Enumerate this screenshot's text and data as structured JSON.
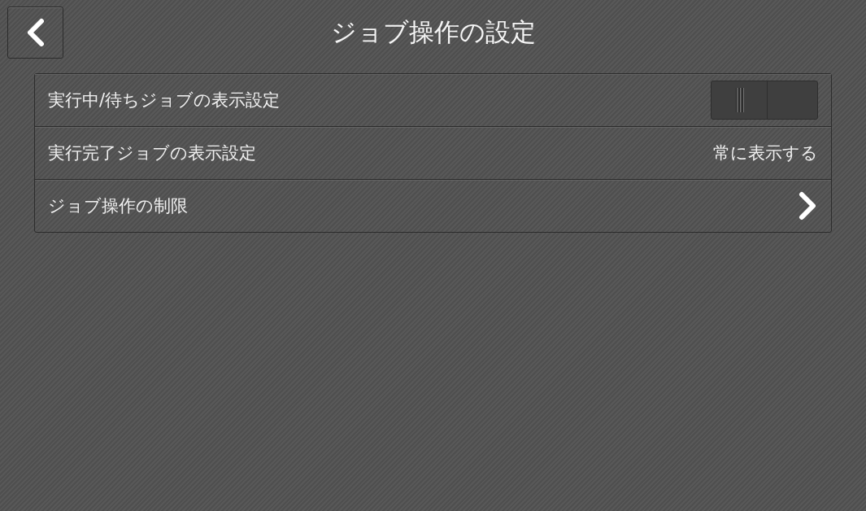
{
  "header": {
    "title": "ジョブ操作の設定"
  },
  "settings": [
    {
      "kind": "toggle",
      "label": "実行中/待ちジョブの表示設定",
      "on": false
    },
    {
      "kind": "value",
      "label": "実行完了ジョブの表示設定",
      "value": "常に表示する"
    },
    {
      "kind": "link",
      "label": "ジョブ操作の制限"
    }
  ]
}
